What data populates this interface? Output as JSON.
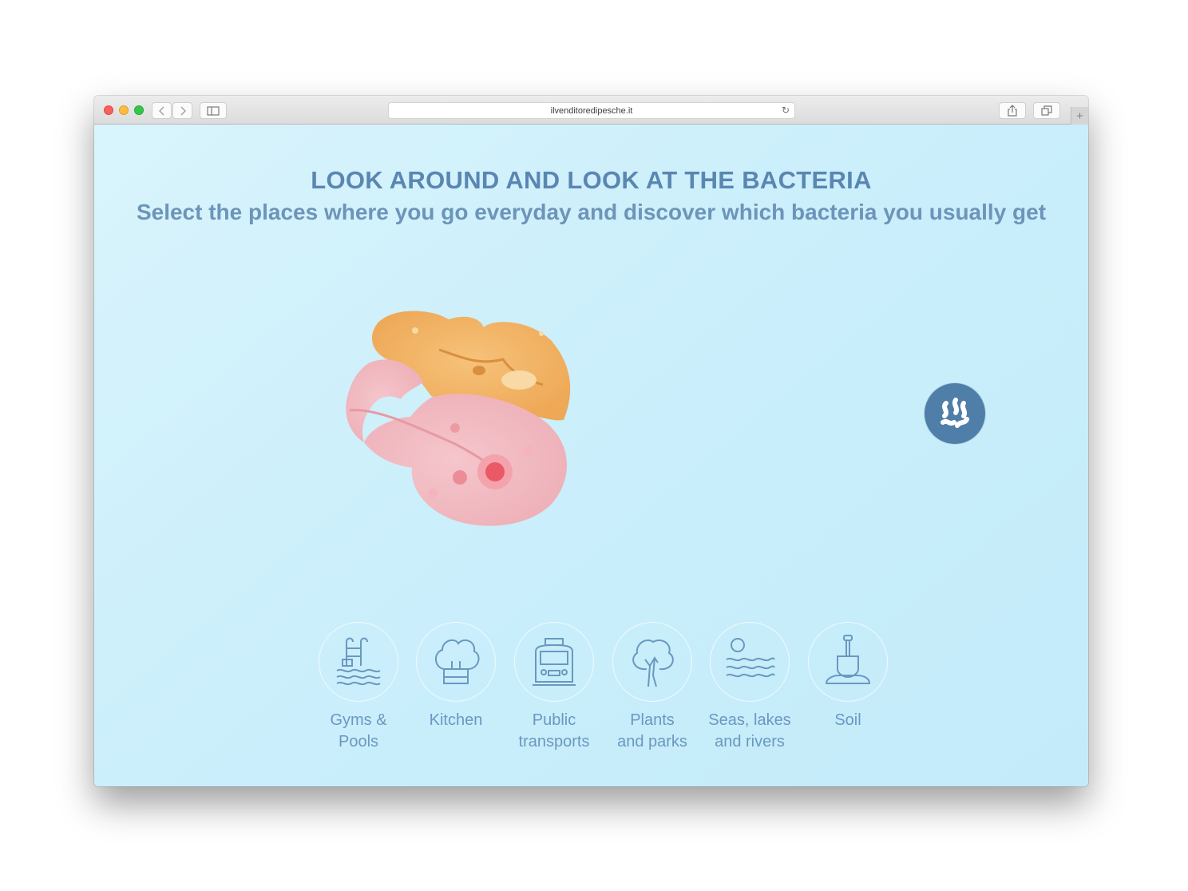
{
  "browser": {
    "url": "ilvenditoredipesche.it",
    "back_icon": "chevron-left-icon",
    "forward_icon": "chevron-right-icon",
    "sidebar_icon": "sidebar-icon",
    "reload_icon": "reload-icon",
    "share_icon": "share-icon",
    "tabs_icon": "tabs-icon",
    "new_tab_label": "+"
  },
  "page": {
    "title": "LOOK AROUND AND LOOK AT THE BACTERIA",
    "subtitle": "Select the places where you go everyday and discover which bacteria you usually get",
    "bacteria_button_icon": "bacteria-icon",
    "places": [
      {
        "label": "Gyms &\nPools",
        "icon": "pool-icon"
      },
      {
        "label": "Kitchen",
        "icon": "chef-hat-icon"
      },
      {
        "label": "Public\ntransports",
        "icon": "train-icon"
      },
      {
        "label": "Plants\nand parks",
        "icon": "tree-icon"
      },
      {
        "label": "Seas, lakes\nand rivers",
        "icon": "waves-icon"
      },
      {
        "label": "Soil",
        "icon": "shovel-icon"
      }
    ]
  },
  "colors": {
    "background": "#cdeefb",
    "heading": "#5a86b2",
    "button": "#4f7ea9",
    "orange_culture": "#f2b466",
    "pink_culture": "#f2b9c0"
  }
}
